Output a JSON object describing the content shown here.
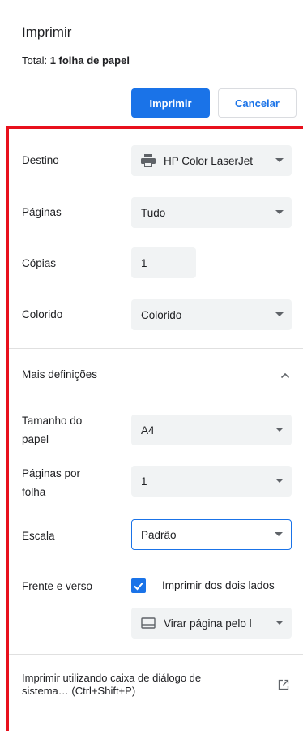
{
  "header": {
    "title": "Imprimir",
    "total_prefix": "Total: ",
    "total_value": "1 folha de papel",
    "print_label": "Imprimir",
    "cancel_label": "Cancelar"
  },
  "settings": {
    "destination": {
      "label": "Destino",
      "value": "HP Color LaserJet"
    },
    "pages": {
      "label": "Páginas",
      "value": "Tudo"
    },
    "copies": {
      "label": "Cópias",
      "value": "1"
    },
    "color": {
      "label": "Colorido",
      "value": "Colorido"
    },
    "more": {
      "label": "Mais definições"
    },
    "paper_size": {
      "label_line1": "Tamanho do",
      "label_line2": "papel",
      "value": "A4"
    },
    "pages_per_sheet": {
      "label_line1": "Páginas por",
      "label_line2": "folha",
      "value": "1"
    },
    "scale": {
      "label": "Escala",
      "value": "Padrão"
    },
    "duplex": {
      "label": "Frente e verso",
      "checkbox_label": "Imprimir dos dois lados",
      "checked": true,
      "flip_value": "Virar página pelo l"
    },
    "system_dialog": {
      "line1": "Imprimir utilizando caixa de diálogo de",
      "line2": "sistema… (Ctrl+Shift+P)"
    }
  },
  "colors": {
    "accent": "#1a73e8",
    "highlight_border": "#e8101c"
  }
}
